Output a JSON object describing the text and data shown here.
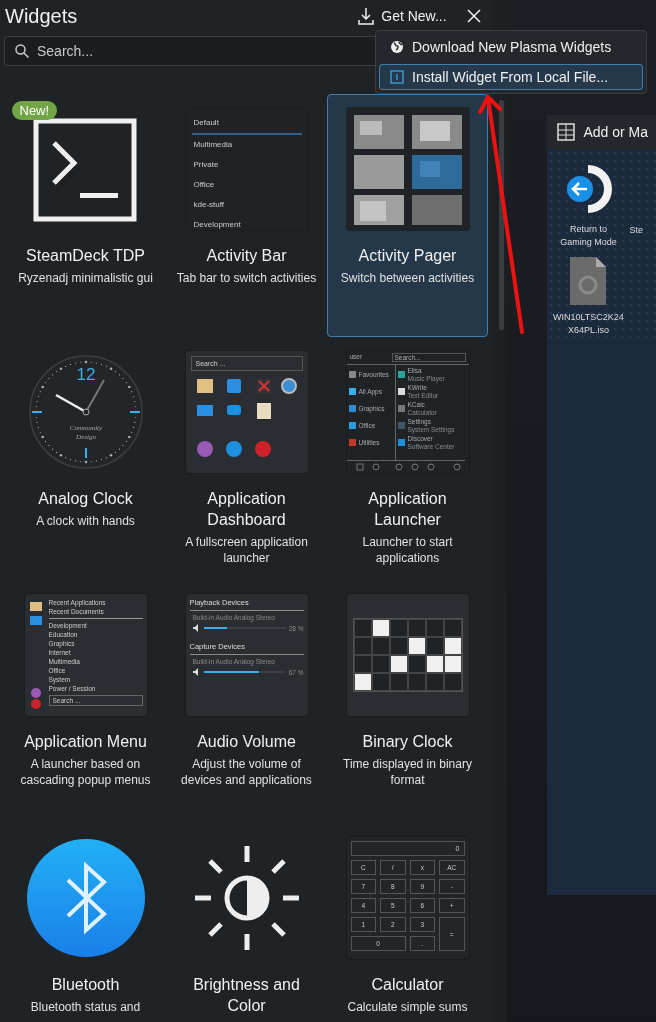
{
  "panel": {
    "title": "Widgets",
    "get_new": "Get New...",
    "search": {
      "placeholder": "Search..."
    }
  },
  "menu": {
    "items": [
      {
        "label": "Download New Plasma Widgets",
        "selected": false
      },
      {
        "label": "Install Widget From Local File...",
        "selected": true
      }
    ]
  },
  "widgets": [
    {
      "name": "SteamDeck TDP",
      "description": "Ryzenadj minimalistic gui",
      "badge": "New!",
      "selected": false,
      "preview": {
        "kind": "terminal"
      }
    },
    {
      "name": "Activity Bar",
      "description": "Tab bar to switch activities",
      "selected": false,
      "preview": {
        "kind": "activity_bar",
        "items": [
          {
            "label": "Default",
            "selected": true
          },
          {
            "label": "Multimedia",
            "selected": false
          },
          {
            "label": "Private",
            "selected": false
          },
          {
            "label": "Office",
            "selected": false
          },
          {
            "label": "kde-stuff",
            "selected": false
          },
          {
            "label": "Development",
            "selected": false
          }
        ]
      }
    },
    {
      "name": "Activity Pager",
      "description": "Switch between activities",
      "selected": true,
      "preview": {
        "kind": "pager"
      }
    },
    {
      "name": "Analog Clock",
      "description": "A clock with hands",
      "selected": false,
      "preview": {
        "kind": "clock",
        "numeral": "12",
        "caption": [
          "Community",
          "Design"
        ]
      }
    },
    {
      "name": "Application Dashboard",
      "description": "A fullscreen application launcher",
      "selected": false,
      "preview": {
        "kind": "dashboard",
        "search": "Search ..."
      }
    },
    {
      "name": "Application Launcher",
      "description": "Launcher to start applications",
      "selected": false,
      "preview": {
        "kind": "launcher",
        "user": "user",
        "search": "Search...",
        "categories": [
          "Favourites",
          "All Apps",
          "Graphics",
          "Office",
          "Utilities"
        ],
        "apps": [
          {
            "name": "Elisa",
            "description": "Music Player"
          },
          {
            "name": "KWrite",
            "description": "Text Editor"
          },
          {
            "name": "KCalc",
            "description": "Calculator"
          },
          {
            "name": "Settings",
            "description": "System Settings"
          },
          {
            "name": "Discover",
            "description": "Software Center"
          }
        ]
      }
    },
    {
      "name": "Application Menu",
      "description": "A launcher based on cascading popup menus",
      "selected": false,
      "preview": {
        "kind": "app_menu",
        "items": [
          "Recent Applications",
          "Recent Documents",
          "Development",
          "Education",
          "Graphics",
          "Internet",
          "Multimedia",
          "Office",
          "System",
          "Power / Session"
        ],
        "search": "Search ..."
      }
    },
    {
      "name": "Audio Volume",
      "description": "Adjust the volume of devices and applications",
      "selected": false,
      "preview": {
        "kind": "audio",
        "sections": [
          {
            "title": "Playback Devices",
            "device": "Build-in Audio Analog Stereo",
            "level": 0.28,
            "reading": "28 %"
          },
          {
            "title": "Capture Devices",
            "device": "Build-in Audio Analog Stereo",
            "level": 0.67,
            "reading": "67 %"
          }
        ]
      }
    },
    {
      "name": "Binary Clock",
      "description": "Time displayed in binary format",
      "selected": false,
      "preview": {
        "kind": "binary_clock",
        "grid": [
          [
            {
              "on": false
            },
            {
              "on": true
            },
            {
              "on": false
            },
            {
              "on": false
            },
            {
              "on": false
            },
            {
              "on": false
            }
          ],
          [
            {
              "on": false
            },
            {
              "on": false
            },
            {
              "on": false
            },
            {
              "on": true
            },
            {
              "on": false
            },
            {
              "on": true
            }
          ],
          [
            {
              "on": false
            },
            {
              "on": false
            },
            {
              "on": true
            },
            {
              "on": false
            },
            {
              "on": true
            },
            {
              "on": true
            }
          ],
          [
            {
              "on": true
            },
            {
              "on": false
            },
            {
              "on": false
            },
            {
              "on": false
            },
            {
              "on": false
            },
            {
              "on": false
            }
          ]
        ]
      }
    },
    {
      "name": "Bluetooth",
      "description": "Bluetooth status and",
      "selected": false,
      "preview": {
        "kind": "bluetooth"
      }
    },
    {
      "name": "Brightness and Color",
      "selected": false,
      "preview": {
        "kind": "brightness"
      }
    },
    {
      "name": "Calculator",
      "description": "Calculate simple sums",
      "selected": false,
      "preview": {
        "kind": "calculator",
        "display": "0",
        "keys": [
          {
            "label": "C",
            "kind": "normal"
          },
          {
            "label": "/",
            "kind": "normal"
          },
          {
            "label": "x",
            "kind": "normal"
          },
          {
            "label": "AC",
            "kind": "normal"
          },
          {
            "label": "7",
            "kind": "normal"
          },
          {
            "label": "8",
            "kind": "normal"
          },
          {
            "label": "9",
            "kind": "normal"
          },
          {
            "label": "-",
            "kind": "normal"
          },
          {
            "label": "4",
            "kind": "normal"
          },
          {
            "label": "5",
            "kind": "normal"
          },
          {
            "label": "6",
            "kind": "normal"
          },
          {
            "label": "+",
            "kind": "normal"
          },
          {
            "label": "1",
            "kind": "normal"
          },
          {
            "label": "2",
            "kind": "normal"
          },
          {
            "label": "3",
            "kind": "normal"
          },
          {
            "label": "=",
            "kind": "tall"
          },
          {
            "label": "0",
            "kind": "wide"
          },
          {
            "label": ".",
            "kind": "normal"
          }
        ]
      }
    }
  ],
  "desktop": {
    "window": {
      "title": "Add or Ma",
      "icons": [
        {
          "label": "Return to Gaming Mode",
          "kind": "return"
        },
        {
          "label": "Ste",
          "kind": "none"
        },
        {
          "label": "WIN10LTSC2K24 X64PL.iso",
          "kind": "disc_file"
        }
      ]
    }
  }
}
